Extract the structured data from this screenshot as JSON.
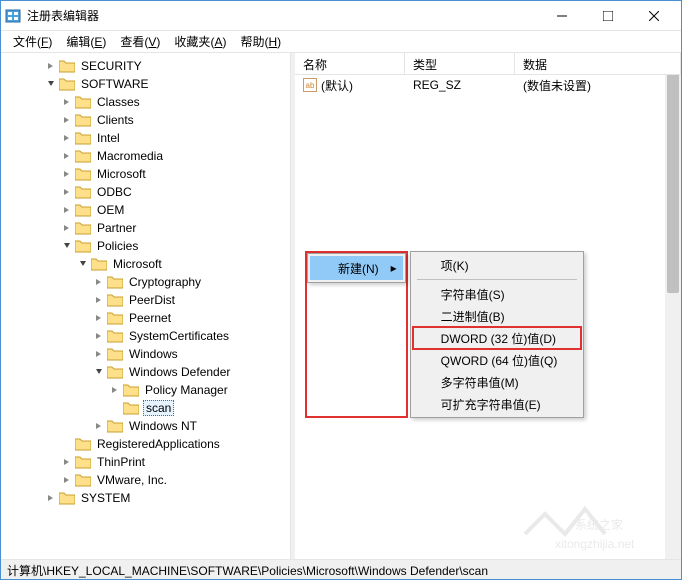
{
  "window": {
    "title": "注册表编辑器"
  },
  "menubar": {
    "file": {
      "label": "文件",
      "key": "F"
    },
    "edit": {
      "label": "编辑",
      "key": "E"
    },
    "view": {
      "label": "查看",
      "key": "V"
    },
    "fav": {
      "label": "收藏夹",
      "key": "A"
    },
    "help": {
      "label": "帮助",
      "key": "H"
    }
  },
  "tree": {
    "security": "SECURITY",
    "software": "SOFTWARE",
    "classes": "Classes",
    "clients": "Clients",
    "intel": "Intel",
    "macromedia": "Macromedia",
    "microsoft": "Microsoft",
    "odbc": "ODBC",
    "oem": "OEM",
    "partner": "Partner",
    "policies": "Policies",
    "policies_ms": "Microsoft",
    "crypto": "Cryptography",
    "peerdist": "PeerDist",
    "peernet": "Peernet",
    "syscert": "SystemCertificates",
    "windows": "Windows",
    "wd": "Windows Defender",
    "pm": "Policy Manager",
    "scan": "scan",
    "winnt": "Windows NT",
    "regapps": "RegisteredApplications",
    "thinprint": "ThinPrint",
    "vmware": "VMware, Inc.",
    "system": "SYSTEM"
  },
  "list": {
    "headers": {
      "name": "名称",
      "type": "类型",
      "data": "数据"
    },
    "rows": [
      {
        "icon": "ab",
        "name": "(默认)",
        "type": "REG_SZ",
        "data": "(数值未设置)"
      }
    ]
  },
  "ctx1": {
    "new": "新建(N)"
  },
  "ctx2": {
    "key": "项(K)",
    "string": "字符串值(S)",
    "binary": "二进制值(B)",
    "dword": "DWORD (32 位)值(D)",
    "qword": "QWORD (64 位)值(Q)",
    "multi": "多字符串值(M)",
    "expand": "可扩充字符串值(E)"
  },
  "statusbar": {
    "path": "计算机\\HKEY_LOCAL_MACHINE\\SOFTWARE\\Policies\\Microsoft\\Windows Defender\\scan"
  },
  "watermark": {
    "text": "系统之家",
    "url": "xitongzhijia.net"
  }
}
